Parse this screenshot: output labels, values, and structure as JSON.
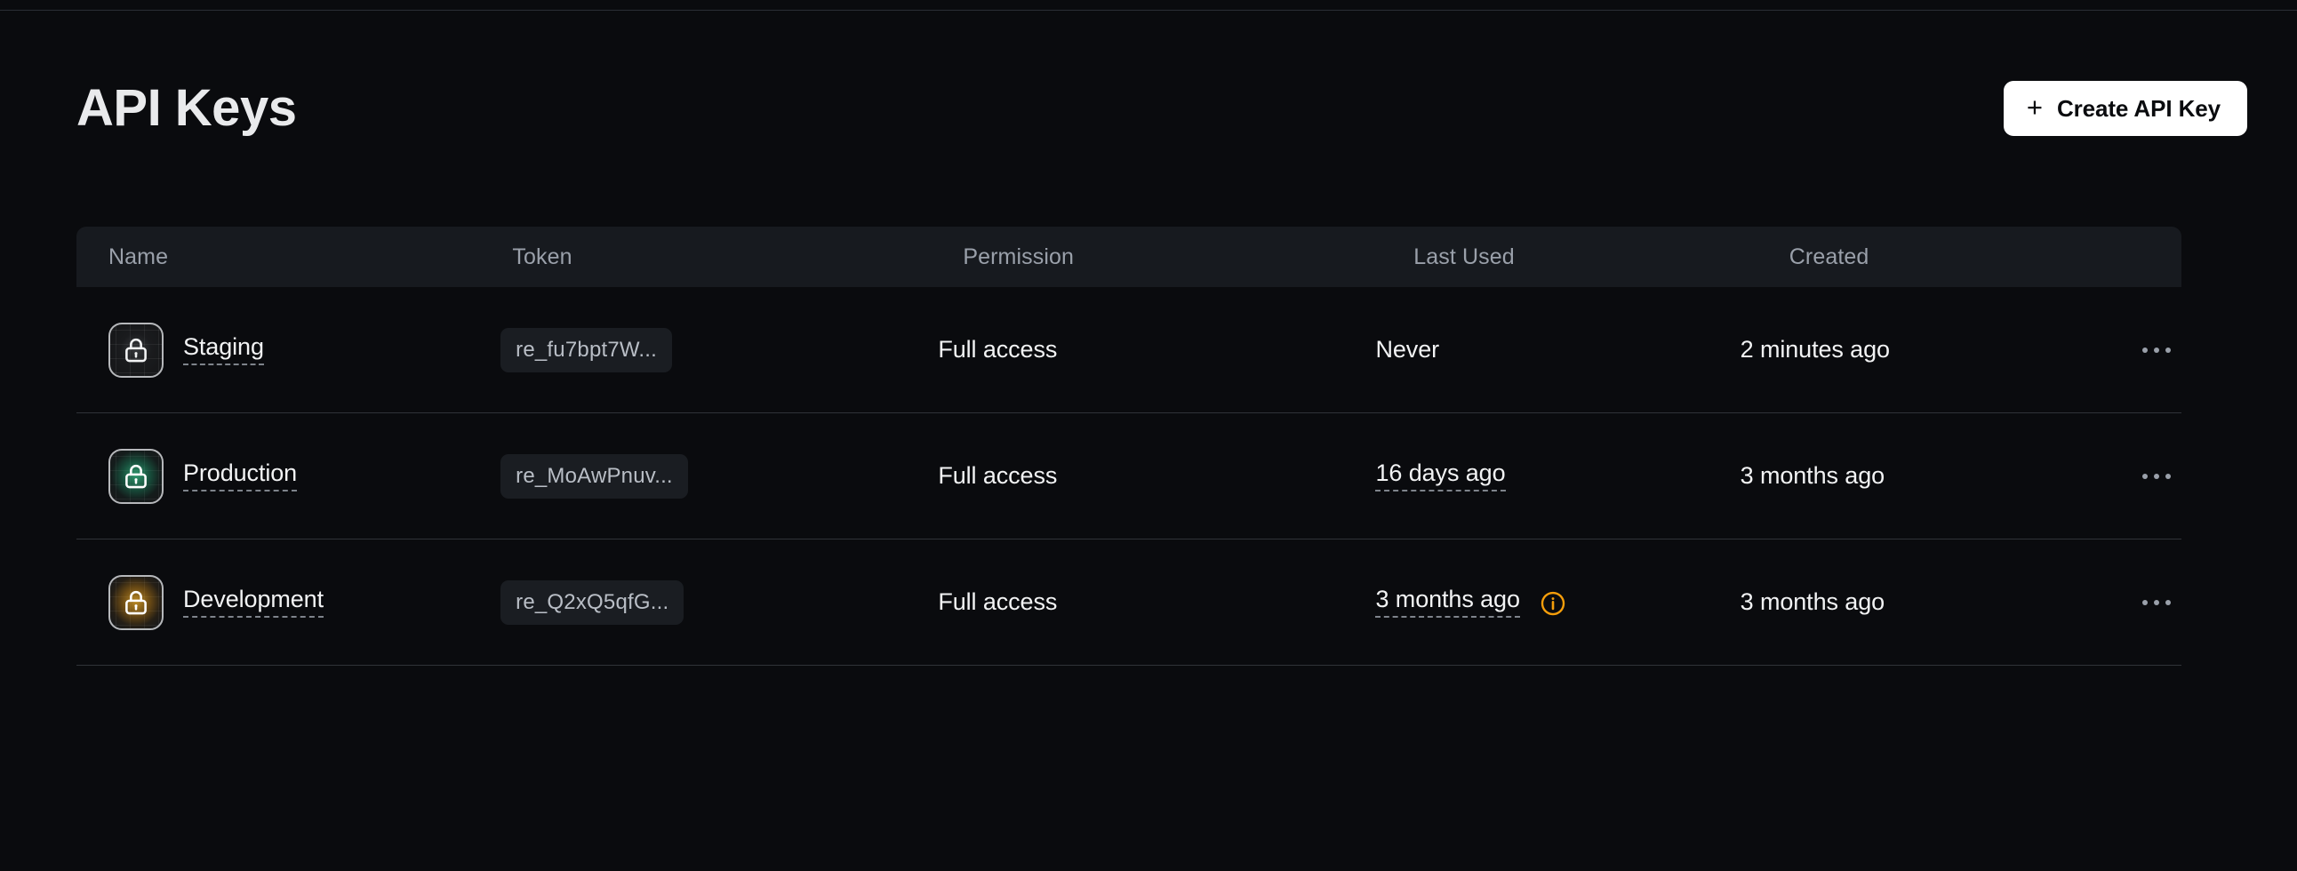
{
  "header": {
    "title": "API Keys",
    "create_button": {
      "label": "Create API Key",
      "plus": "+"
    }
  },
  "table": {
    "columns": [
      {
        "key": "name",
        "label": "Name"
      },
      {
        "key": "token",
        "label": "Token"
      },
      {
        "key": "permission",
        "label": "Permission"
      },
      {
        "key": "last_used",
        "label": "Last Used"
      },
      {
        "key": "created",
        "label": "Created"
      }
    ],
    "rows": [
      {
        "icon": "lock-icon",
        "icon_variant": "gray",
        "name": "Staging",
        "token": "re_fu7bpt7W...",
        "permission": "Full access",
        "last_used": "Never",
        "last_used_dashed": false,
        "warning": false,
        "created": "2 minutes ago",
        "actions": "row-actions-menu"
      },
      {
        "icon": "lock-icon",
        "icon_variant": "green",
        "name": "Production",
        "token": "re_MoAwPnuv...",
        "permission": "Full access",
        "last_used": "16 days ago",
        "last_used_dashed": true,
        "warning": false,
        "created": "3 months ago",
        "actions": "row-actions-menu"
      },
      {
        "icon": "lock-icon",
        "icon_variant": "amber",
        "name": "Development",
        "token": "re_Q2xQ5qfG...",
        "permission": "Full access",
        "last_used": "3 months ago",
        "last_used_dashed": true,
        "warning": true,
        "warning_icon": "info-circle-icon",
        "created": "3 months ago",
        "actions": "row-actions-menu"
      }
    ]
  },
  "colors": {
    "background": "#0a0b0e",
    "header_row_bg": "#171a1f",
    "row_divider": "#303338",
    "text_primary": "#f2f3f4",
    "text_muted": "#9aa0aa",
    "accent_button": "#ffffff",
    "warning": "#f59e0b",
    "glow_green": "#3ce6a0",
    "glow_amber": "#ffb928"
  }
}
